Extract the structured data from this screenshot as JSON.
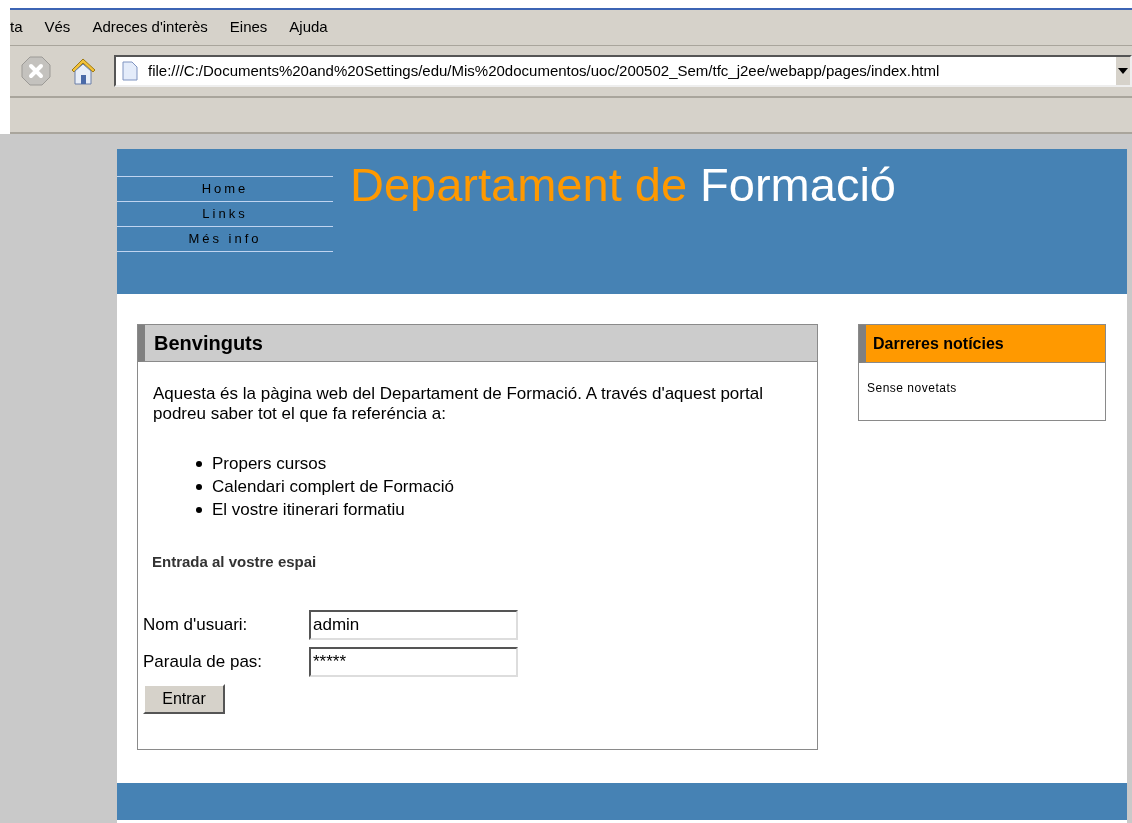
{
  "menu_bar": {
    "items": [
      "ta",
      "Vés",
      "Adreces d'interès",
      "Eines",
      "Ajuda"
    ]
  },
  "address_bar": {
    "value": "file:///C:/Documents%20and%20Settings/edu/Mis%20documentos/uoc/200502_Sem/tfc_j2ee/webapp/pages/index.html"
  },
  "header": {
    "nav": [
      "Home",
      "Links",
      "Més info"
    ],
    "title_part_1": "Departament de",
    "title_part_2": "Formació"
  },
  "welcome_panel": {
    "title": "Benvinguts",
    "intro": "Aquesta és la pàgina web del Departament de Formació. A través d'aquest portal podreu saber tot el que fa referéncia a:",
    "list": [
      "Propers cursos",
      "Calendari complert de Formació",
      "El vostre itinerari formatiu"
    ],
    "login_heading": "Entrada al vostre espai",
    "fields": [
      {
        "label": "Nom d'usuari:",
        "value": "admin"
      },
      {
        "label": "Paraula de pas:",
        "value": "*****"
      }
    ],
    "submit": "Entrar"
  },
  "news_panel": {
    "title": "Darreres notícies",
    "text": "Sense novetats"
  }
}
